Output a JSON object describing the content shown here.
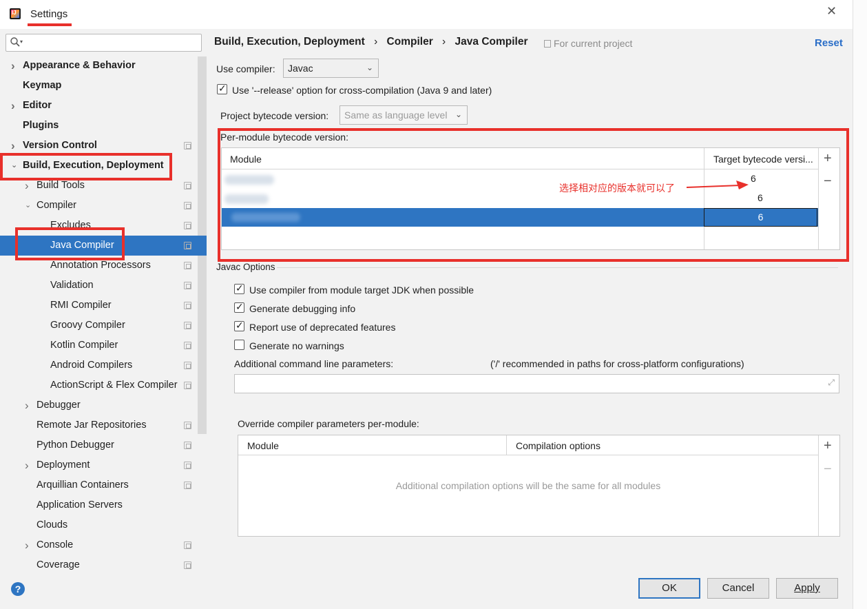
{
  "window": {
    "title": "Settings",
    "close_glyph": "✕"
  },
  "search": {
    "placeholder": "",
    "icon": "search-icon"
  },
  "sidebar": {
    "items": [
      {
        "label": "Appearance & Behavior",
        "bold": true,
        "arrow": "right"
      },
      {
        "label": "Keymap",
        "bold": true
      },
      {
        "label": "Editor",
        "bold": true,
        "arrow": "right"
      },
      {
        "label": "Plugins",
        "bold": true
      },
      {
        "label": "Version Control",
        "bold": true,
        "arrow": "right"
      },
      {
        "label": "Build, Execution, Deployment",
        "bold": true,
        "arrow": "down"
      },
      {
        "label": "Build Tools",
        "arrow": "right"
      },
      {
        "label": "Compiler",
        "arrow": "down"
      },
      {
        "label": "Excludes"
      },
      {
        "label": "Java Compiler",
        "selected": true
      },
      {
        "label": "Annotation Processors"
      },
      {
        "label": "Validation"
      },
      {
        "label": "RMI Compiler"
      },
      {
        "label": "Groovy Compiler"
      },
      {
        "label": "Kotlin Compiler"
      },
      {
        "label": "Android Compilers"
      },
      {
        "label": "ActionScript & Flex Compiler"
      },
      {
        "label": "Debugger",
        "arrow": "right"
      },
      {
        "label": "Remote Jar Repositories"
      },
      {
        "label": "Python Debugger"
      },
      {
        "label": "Deployment",
        "arrow": "right"
      },
      {
        "label": "Arquillian Containers"
      },
      {
        "label": "Application Servers"
      },
      {
        "label": "Clouds"
      },
      {
        "label": "Console",
        "arrow": "right"
      },
      {
        "label": "Coverage"
      }
    ]
  },
  "header": {
    "breadcrumb_1": "Build, Execution, Deployment",
    "breadcrumb_2": "Compiler",
    "breadcrumb_3": "Java Compiler",
    "separator": "›",
    "scope": "For current project",
    "reset": "Reset"
  },
  "compiler": {
    "use_compiler_label": "Use compiler:",
    "use_compiler_value": "Javac",
    "release_option_label": "Use '--release' option for cross-compilation (Java 9 and later)",
    "release_option_checked": true,
    "bytecode_label": "Project bytecode version:",
    "bytecode_value": "Same as language level"
  },
  "per_module": {
    "label": "Per-module bytecode version:",
    "columns": [
      "Module",
      "Target bytecode versi..."
    ],
    "rows": [
      {
        "target": "6"
      },
      {
        "target": "6"
      },
      {
        "target": "6",
        "selected": true
      }
    ],
    "add": "+",
    "remove": "−",
    "annotation": "选择相对应的版本就可以了"
  },
  "javac_options": {
    "section_title": "Javac Options",
    "options": [
      {
        "label": "Use compiler from module target JDK when possible",
        "checked": true
      },
      {
        "label": "Generate debugging info",
        "checked": true
      },
      {
        "label": "Report use of deprecated features",
        "checked": true
      },
      {
        "label": "Generate no warnings",
        "checked": false
      }
    ],
    "cmd_label": "Additional command line parameters:",
    "cmd_hint": "('/' recommended in paths for cross-platform configurations)",
    "cmd_value": ""
  },
  "override": {
    "label": "Override compiler parameters per-module:",
    "columns": [
      "Module",
      "Compilation options"
    ],
    "empty_text": "Additional compilation options will be the same for all modules",
    "add": "+",
    "remove": "−"
  },
  "footer": {
    "help": "?",
    "ok": "OK",
    "cancel": "Cancel",
    "apply": "Apply"
  },
  "colors": {
    "selection": "#2e75c2",
    "annotation_red": "#e8302b",
    "link": "#2a6ec8"
  }
}
